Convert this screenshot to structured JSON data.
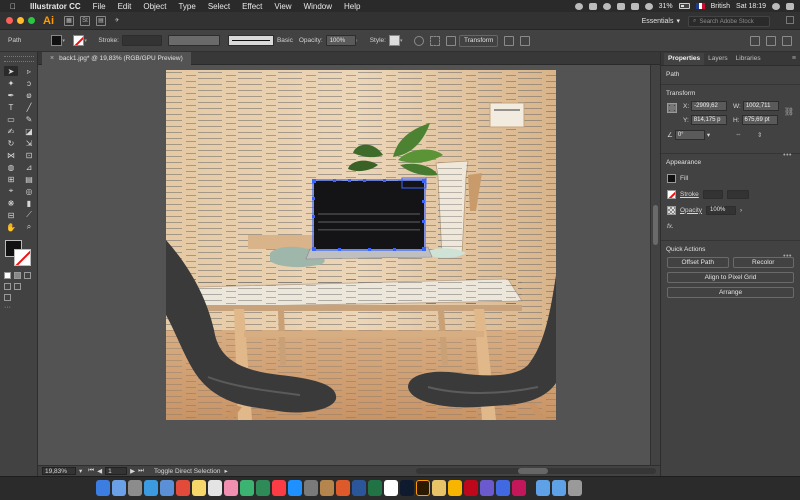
{
  "menubar": {
    "app_name": "Illustrator CC",
    "items": [
      "File",
      "Edit",
      "Object",
      "Type",
      "Select",
      "Effect",
      "View",
      "Window",
      "Help"
    ],
    "battery": "31%",
    "language": "British",
    "clock": "Sat 18:19"
  },
  "appbar": {
    "logo": "Ai",
    "workspace": "Essentials",
    "search_placeholder": "Search Adobe Stock"
  },
  "controlbar": {
    "selection_type": "Path",
    "stroke_label": "Stroke:",
    "stroke_profile": "Basic",
    "opacity_label": "Opacity:",
    "opacity_value": "100%",
    "style_label": "Style:",
    "transform_button": "Transform"
  },
  "document": {
    "tab_title": "back1.jpg* @ 19,83% (RGB/GPU Preview)"
  },
  "statusbar": {
    "zoom": "19,83%",
    "artboard": "1",
    "tool_hint": "Toggle Direct Selection"
  },
  "rightpanel": {
    "tabs": [
      "Properties",
      "Layers",
      "Libraries"
    ],
    "selection_label": "Path",
    "transform": {
      "title": "Transform",
      "x_label": "X:",
      "x_value": "-2909,62",
      "y_label": "Y:",
      "y_value": "814,175 p",
      "w_label": "W:",
      "w_value": "1002,711",
      "h_label": "H:",
      "h_value": "675,69 pt",
      "angle_value": "0°"
    },
    "appearance": {
      "title": "Appearance",
      "fill_label": "Fill",
      "stroke_label": "Stroke",
      "opacity_label": "Opacity",
      "opacity_value": "100%",
      "fx_label": "fx."
    },
    "quick_actions": {
      "title": "Quick Actions",
      "offset_path": "Offset Path",
      "recolor": "Recolor",
      "align_pixel": "Align to Pixel Grid",
      "arrange": "Arrange"
    }
  },
  "colors": {
    "accent_orange": "#ff9a00",
    "selection_blue": "#3a64ff",
    "panel_bg": "#424242",
    "canvas_bg": "#535353"
  }
}
